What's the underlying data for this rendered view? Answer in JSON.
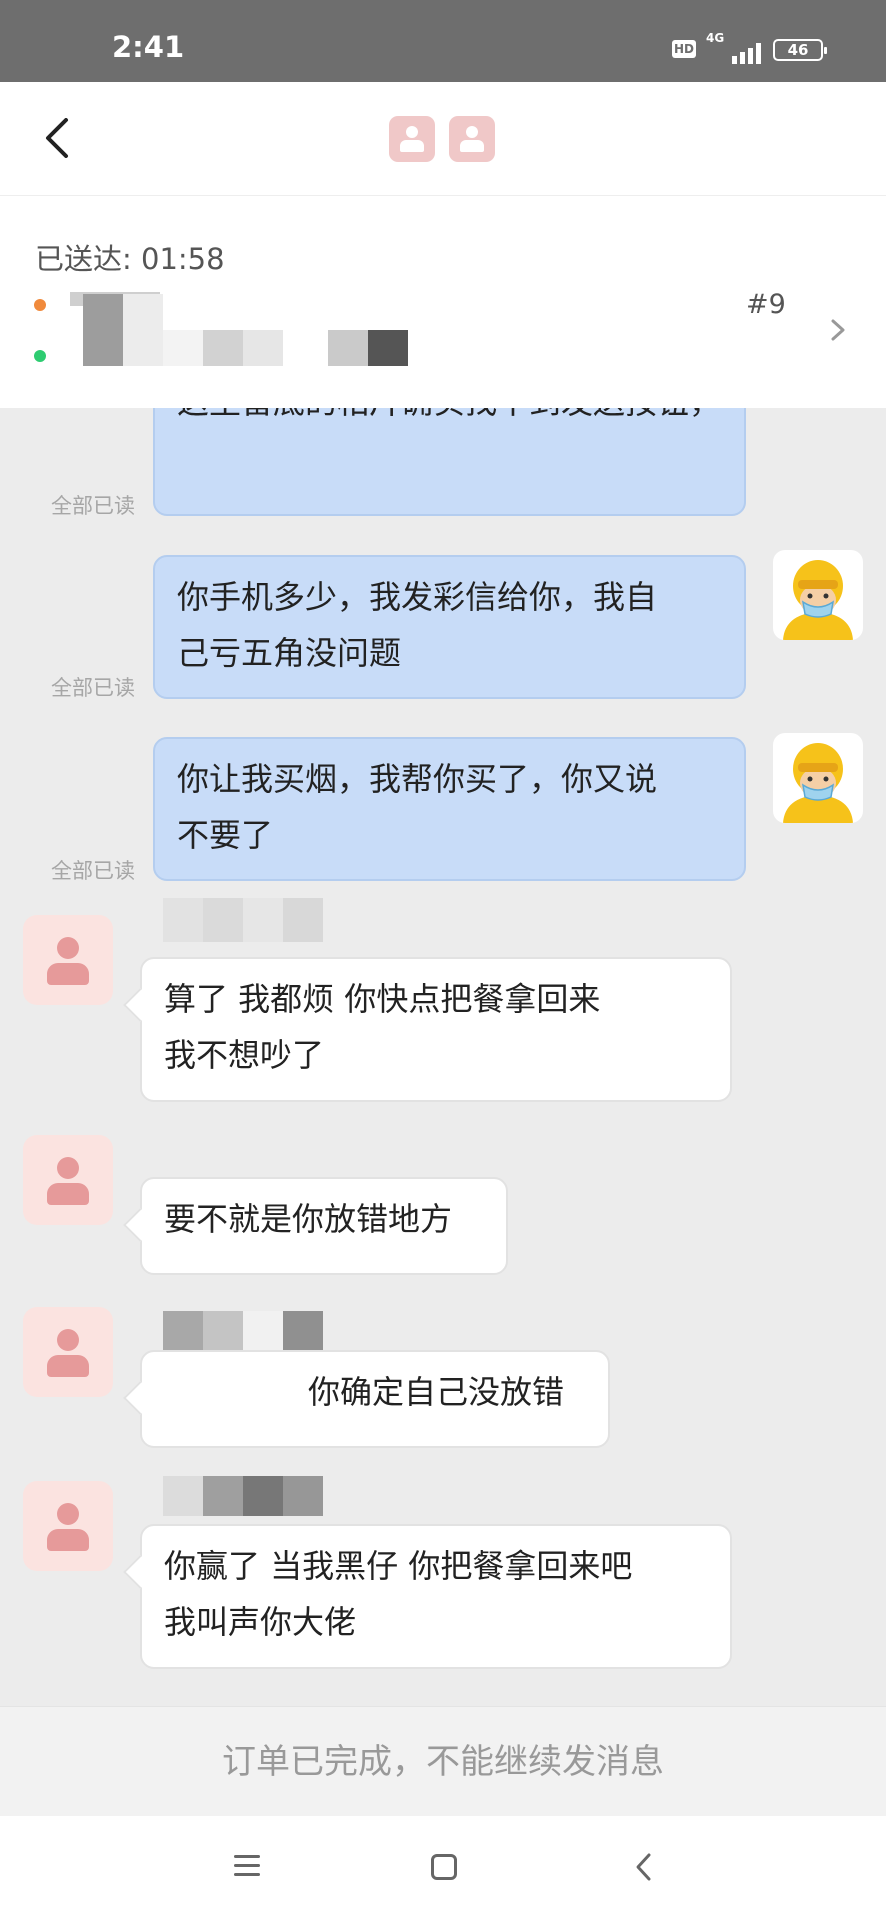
{
  "status_bar": {
    "time": "2:41",
    "hd": "HD",
    "network": "4G",
    "battery": "46"
  },
  "header": {
    "back_icon": "chevron-left-icon",
    "avatars": [
      "user-avatar-icon",
      "user-avatar-icon"
    ]
  },
  "order": {
    "delivered": "已送达: 01:58",
    "order_number": "#9",
    "dot_colors": [
      "#f08a3c",
      "#2ecc71"
    ]
  },
  "chat": {
    "partial_message": "这里留底的相片确实找不到发送按钮，",
    "read_label": "全部已读",
    "messages": [
      {
        "from": "rider",
        "lines": [
          "你手机多少，我发彩信给你，我自",
          "己亏五角没问题"
        ]
      },
      {
        "from": "rider",
        "lines": [
          "你让我买烟，我帮你买了，你又说",
          "不要了"
        ]
      },
      {
        "from": "customer",
        "lines": [
          "算了 我都烦  你快点把餐拿回来",
          "我不想吵了"
        ]
      },
      {
        "from": "customer",
        "lines": [
          "要不就是你放错地方"
        ]
      },
      {
        "from": "customer",
        "lines": [
          "你确定自己没放错"
        ]
      },
      {
        "from": "customer",
        "lines": [
          "你赢了  当我黑仔  你把餐拿回来吧",
          "我叫声你大佬"
        ]
      }
    ]
  },
  "footer": {
    "notice": "订单已完成，不能继续发消息"
  },
  "colors": {
    "bubble_out": "#c8dcf8",
    "bubble_in": "#ffffff",
    "background": "#ececec"
  }
}
